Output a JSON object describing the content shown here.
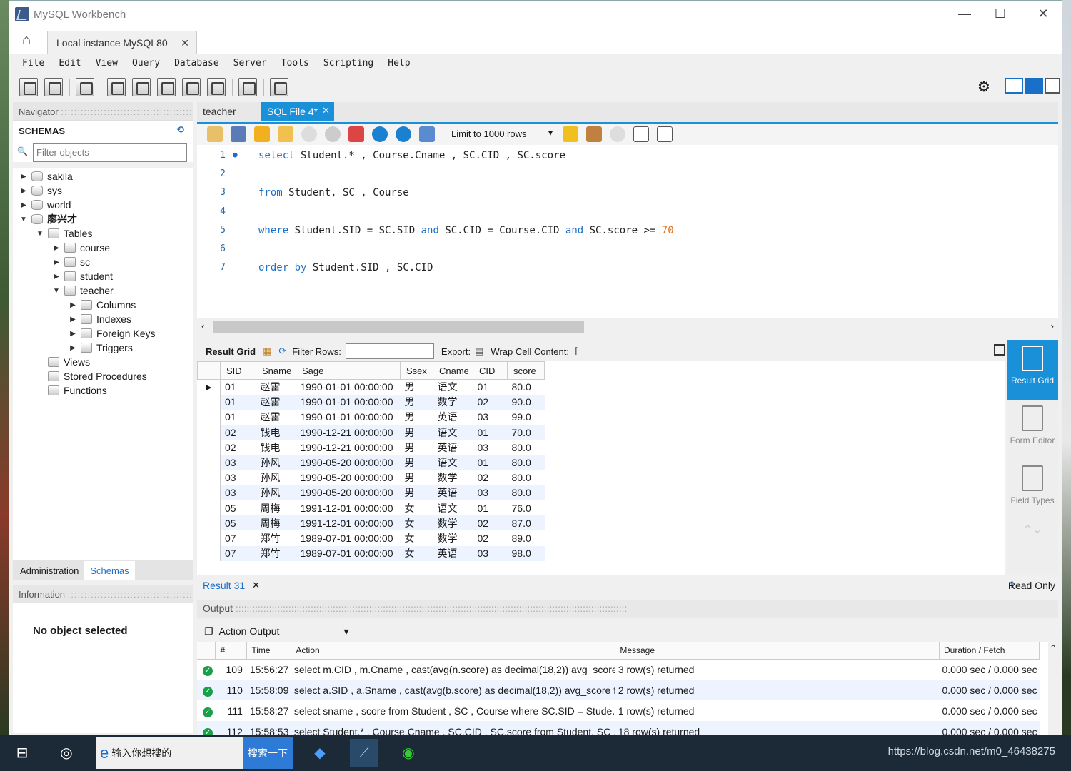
{
  "window": {
    "title": "MySQL Workbench",
    "controls": [
      "—",
      "☐",
      "✕"
    ]
  },
  "connection_tab": {
    "label": "Local instance MySQL80",
    "close": "✕"
  },
  "menu": [
    "File",
    "Edit",
    "View",
    "Query",
    "Database",
    "Server",
    "Tools",
    "Scripting",
    "Help"
  ],
  "navigator": {
    "header": "Navigator",
    "schemas_label": "SCHEMAS",
    "filter_placeholder": "Filter objects",
    "tree": [
      {
        "label": "sakila",
        "arrow": "▶",
        "indent": 0,
        "kind": "db"
      },
      {
        "label": "sys",
        "arrow": "▶",
        "indent": 0,
        "kind": "db"
      },
      {
        "label": "world",
        "arrow": "▶",
        "indent": 0,
        "kind": "db"
      },
      {
        "label": "廖兴才",
        "arrow": "▼",
        "indent": 0,
        "kind": "db",
        "bold": true
      },
      {
        "label": "Tables",
        "arrow": "▼",
        "indent": 1,
        "kind": "folder"
      },
      {
        "label": "course",
        "arrow": "▶",
        "indent": 2,
        "kind": "table"
      },
      {
        "label": "sc",
        "arrow": "▶",
        "indent": 2,
        "kind": "table"
      },
      {
        "label": "student",
        "arrow": "▶",
        "indent": 2,
        "kind": "table"
      },
      {
        "label": "teacher",
        "arrow": "▼",
        "indent": 2,
        "kind": "table"
      },
      {
        "label": "Columns",
        "arrow": "▶",
        "indent": 3,
        "kind": "folder"
      },
      {
        "label": "Indexes",
        "arrow": "▶",
        "indent": 3,
        "kind": "folder"
      },
      {
        "label": "Foreign Keys",
        "arrow": "▶",
        "indent": 3,
        "kind": "folder"
      },
      {
        "label": "Triggers",
        "arrow": "▶",
        "indent": 3,
        "kind": "folder"
      },
      {
        "label": "Views",
        "arrow": "",
        "indent": 1,
        "kind": "folder"
      },
      {
        "label": "Stored Procedures",
        "arrow": "",
        "indent": 1,
        "kind": "folder"
      },
      {
        "label": "Functions",
        "arrow": "",
        "indent": 1,
        "kind": "folder"
      }
    ],
    "tabs": [
      "Administration",
      "Schemas"
    ],
    "info_header": "Information",
    "info_text": "No object selected"
  },
  "editor_tabs": [
    {
      "label": "teacher",
      "active": false
    },
    {
      "label": "SQL File 4*",
      "active": true
    }
  ],
  "limit_label": "Limit to 1000 rows",
  "sql_lines": [
    {
      "n": "1",
      "bp": "●",
      "tokens": [
        [
          "kw",
          "select"
        ],
        [
          "t",
          " Student.* , Course.Cname , SC.CID , SC.score"
        ]
      ]
    },
    {
      "n": "2",
      "bp": "",
      "tokens": []
    },
    {
      "n": "3",
      "bp": "",
      "tokens": [
        [
          "kw",
          "from"
        ],
        [
          "t",
          " Student, SC , Course"
        ]
      ]
    },
    {
      "n": "4",
      "bp": "",
      "tokens": []
    },
    {
      "n": "5",
      "bp": "",
      "tokens": [
        [
          "kw",
          "where"
        ],
        [
          "t",
          " Student.SID = SC.SID "
        ],
        [
          "kw",
          "and"
        ],
        [
          "t",
          " SC.CID = Course.CID "
        ],
        [
          "kw",
          "and"
        ],
        [
          "t",
          " SC.score >= "
        ],
        [
          "num",
          "70"
        ]
      ]
    },
    {
      "n": "6",
      "bp": "",
      "tokens": []
    },
    {
      "n": "7",
      "bp": "",
      "tokens": [
        [
          "kw",
          "order by"
        ],
        [
          "t",
          " Student.SID , SC.CID"
        ]
      ]
    }
  ],
  "result_toolbar": {
    "grid_label": "Result Grid",
    "filter_label": "Filter Rows:",
    "export_label": "Export:",
    "wrap_label": "Wrap Cell Content:"
  },
  "result_columns": [
    "SID",
    "Sname",
    "Sage",
    "Ssex",
    "Cname",
    "CID",
    "score"
  ],
  "result_rows": [
    [
      "01",
      "赵雷",
      "1990-01-01 00:00:00",
      "男",
      "语文",
      "01",
      "80.0"
    ],
    [
      "01",
      "赵雷",
      "1990-01-01 00:00:00",
      "男",
      "数学",
      "02",
      "90.0"
    ],
    [
      "01",
      "赵雷",
      "1990-01-01 00:00:00",
      "男",
      "英语",
      "03",
      "99.0"
    ],
    [
      "02",
      "钱电",
      "1990-12-21 00:00:00",
      "男",
      "语文",
      "01",
      "70.0"
    ],
    [
      "02",
      "钱电",
      "1990-12-21 00:00:00",
      "男",
      "英语",
      "03",
      "80.0"
    ],
    [
      "03",
      "孙风",
      "1990-05-20 00:00:00",
      "男",
      "语文",
      "01",
      "80.0"
    ],
    [
      "03",
      "孙风",
      "1990-05-20 00:00:00",
      "男",
      "数学",
      "02",
      "80.0"
    ],
    [
      "03",
      "孙风",
      "1990-05-20 00:00:00",
      "男",
      "英语",
      "03",
      "80.0"
    ],
    [
      "05",
      "周梅",
      "1991-12-01 00:00:00",
      "女",
      "语文",
      "01",
      "76.0"
    ],
    [
      "05",
      "周梅",
      "1991-12-01 00:00:00",
      "女",
      "数学",
      "02",
      "87.0"
    ],
    [
      "07",
      "郑竹",
      "1989-07-01 00:00:00",
      "女",
      "数学",
      "02",
      "89.0"
    ],
    [
      "07",
      "郑竹",
      "1989-07-01 00:00:00",
      "女",
      "英语",
      "03",
      "98.0"
    ]
  ],
  "side_panel": [
    {
      "label": "Result Grid",
      "active": true
    },
    {
      "label": "Form Editor",
      "active": false
    },
    {
      "label": "Field Types",
      "active": false
    }
  ],
  "result_tab": {
    "label": "Result 31",
    "close": "✕",
    "readonly": "Read Only"
  },
  "output": {
    "header": "Output",
    "selector": "Action Output",
    "columns": [
      "#",
      "Time",
      "Action",
      "Message",
      "Duration / Fetch"
    ],
    "rows": [
      [
        "109",
        "15:56:27",
        "select m.CID , m.Cname , cast(avg(n.score) as decimal(18,2)) avg_score ...",
        "3 row(s) returned",
        "0.000 sec / 0.000 sec"
      ],
      [
        "110",
        "15:58:09",
        "select a.SID , a.Sname , cast(avg(b.score) as decimal(18,2)) avg_score f...",
        "2 row(s) returned",
        "0.000 sec / 0.000 sec"
      ],
      [
        "111",
        "15:58:27",
        "select sname , score  from Student , SC , Course  where SC.SID = Stude...",
        "1 row(s) returned",
        "0.000 sec / 0.000 sec"
      ],
      [
        "112",
        "15:58:53",
        "select Student.* , Course.Cname , SC.CID , SC.score  from Student, SC , ...",
        "18 row(s) returned",
        "0.000 sec / 0.000 sec"
      ]
    ]
  },
  "taskbar": {
    "search_placeholder": "输入你想搜的",
    "search_button": "搜索一下",
    "tray": "https://blog.csdn.net/m0_46438275"
  },
  "colors": {
    "accent": "#1a90d8",
    "keyword": "#1a70c8",
    "number": "#e07020",
    "ok": "#1aa048"
  }
}
